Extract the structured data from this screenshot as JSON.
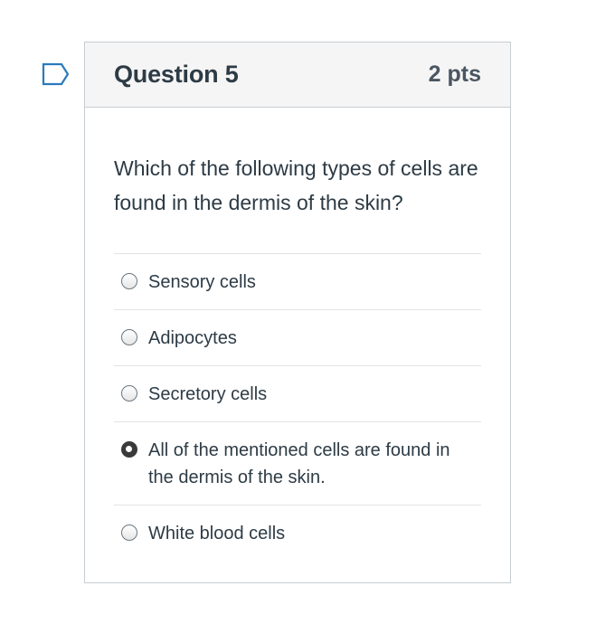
{
  "question": {
    "title": "Question 5",
    "points": "2 pts",
    "text": "Which of the following types of cells are found in the dermis of the skin?",
    "answers": [
      {
        "label": "Sensory cells",
        "selected": false
      },
      {
        "label": "Adipocytes",
        "selected": false
      },
      {
        "label": "Secretory cells",
        "selected": false
      },
      {
        "label": "All of the mentioned cells are found in the dermis of the skin.",
        "selected": true
      },
      {
        "label": "White blood cells",
        "selected": false
      }
    ]
  },
  "colors": {
    "text": "#2d3b45",
    "header_bg": "#f5f5f5",
    "border": "#c7cdd1",
    "flag": "#2b7abc"
  }
}
